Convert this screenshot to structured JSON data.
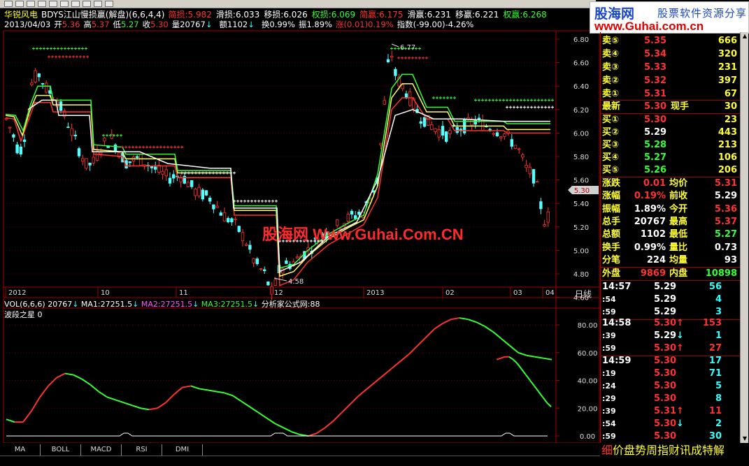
{
  "app": {
    "stock_name": "华锐风电",
    "formula": "BDYS江山慢损赢(解盘)(6,6,4,4)",
    "period": "日线"
  },
  "indicators_row1": [
    {
      "label": "简损:",
      "value": "5.982",
      "color": "red"
    },
    {
      "label": "滑损:",
      "value": "6.033",
      "color": "white"
    },
    {
      "label": "移损:",
      "value": "6.026",
      "color": "white"
    },
    {
      "label": "权损:",
      "value": "6.069",
      "color": "green"
    },
    {
      "label": "简赢:",
      "value": "6.175",
      "color": "red"
    },
    {
      "label": "滑赢:",
      "value": "6.231",
      "color": "white"
    },
    {
      "label": "移赢:",
      "value": "6.221",
      "color": "white"
    },
    {
      "label": "权赢:",
      "value": "6.268",
      "color": "green"
    }
  ],
  "ohlc_row": {
    "date": "2013/04/03",
    "open_label": "开",
    "open": "5.36",
    "high_label": "高",
    "high": "5.37",
    "low_label": "低",
    "low": "5.27",
    "close_label": "收",
    "close": "5.30",
    "vol_label": "量",
    "vol": "20767",
    "amt_label": "额",
    "amt": "1102",
    "turn_label": "换",
    "turn": "0.99%",
    "amp_label": "振",
    "amp": "1.89%",
    "chg_label": "涨",
    "chg": "(0.01)0.19%",
    "idx_label": "指数",
    "idx": "(-99.00)-4.26%"
  },
  "watermark": "股海网 Www.Guhai.Com.CN",
  "logo": {
    "title": "股海网",
    "subtitle": "股票软件资源分享",
    "url": "www.Guhai.com.cn"
  },
  "price_axis": [
    "6.80",
    "6.60",
    "6.40",
    "6.20",
    "6.00",
    "5.80",
    "5.60",
    "5.40",
    "5.20",
    "5.00",
    "4.80",
    "4.60"
  ],
  "current_price_tag": "5.30",
  "high_annotation": "6.77",
  "low_annotation": "4.58",
  "time_axis": [
    "2012",
    "10",
    "11",
    "12",
    "2013",
    "02",
    "03",
    "04"
  ],
  "vol_row": {
    "label": "VOL(6,6,6)",
    "vol": "20767",
    "ma1": "MA1:27251.5",
    "ma2": "MA2:27251.5",
    "ma3": "MA3:27251.5",
    "source": "分析家公式网:88"
  },
  "sub_indicator": {
    "name": "波段之星",
    "value": "0"
  },
  "sub_axis": [
    "80.00",
    "60.00",
    "40.00",
    "20.00",
    "0.00"
  ],
  "chart_data": {
    "type": "line",
    "title": "波段之星",
    "ylim": [
      0,
      90
    ],
    "x": [
      0,
      3,
      6,
      9,
      12,
      15,
      18,
      21,
      24,
      27,
      30,
      33,
      36,
      39,
      42,
      45,
      48,
      51,
      54,
      57,
      60,
      63,
      66,
      69,
      72,
      75,
      78,
      81,
      84,
      87,
      90,
      93,
      96,
      99,
      102,
      105,
      108,
      111,
      114,
      117,
      120,
      123,
      126,
      129,
      132,
      135,
      138,
      141,
      144,
      147,
      150,
      153,
      156,
      159,
      162,
      165,
      168,
      171,
      174,
      177,
      180,
      183,
      186,
      189,
      192,
      195
    ],
    "series": [
      {
        "values": [
          12,
          10,
          10,
          18,
          28,
          36,
          42,
          45,
          44,
          41,
          37,
          32,
          28,
          26,
          24,
          22,
          20,
          19,
          20,
          24,
          30,
          35,
          36,
          34,
          33,
          32,
          31,
          29,
          25,
          21,
          17,
          13,
          9,
          6,
          3,
          1,
          0,
          2,
          6,
          11,
          17,
          23,
          29,
          34,
          39,
          44,
          49,
          54,
          59,
          65,
          71,
          77,
          81,
          84,
          85,
          84,
          82,
          79,
          75,
          70,
          65,
          60,
          58,
          57,
          56,
          55
        ]
      },
      {
        "values": [
          55,
          56,
          57,
          57,
          55,
          52,
          48,
          44,
          40,
          36,
          32,
          28,
          24,
          21
        ]
      }
    ]
  },
  "quote": {
    "sell": [
      {
        "label": "卖⑤",
        "price": "5.35",
        "vol": "666"
      },
      {
        "label": "卖④",
        "price": "5.34",
        "vol": "320"
      },
      {
        "label": "卖③",
        "price": "5.33",
        "vol": "231"
      },
      {
        "label": "卖②",
        "price": "5.32",
        "vol": "397"
      },
      {
        "label": "卖①",
        "price": "5.31",
        "vol": "67"
      }
    ],
    "latest_label": "最新",
    "latest": "5.30",
    "now_label": "现手",
    "now": "30",
    "buy": [
      {
        "label": "买①",
        "price": "5.30",
        "vol": "23"
      },
      {
        "label": "买②",
        "price": "5.29",
        "vol": "443"
      },
      {
        "label": "买③",
        "price": "5.28",
        "vol": "213"
      },
      {
        "label": "买④",
        "price": "5.27",
        "vol": "106"
      },
      {
        "label": "买⑤",
        "price": "5.26",
        "vol": "206"
      }
    ],
    "stats": [
      {
        "l1": "涨跌",
        "v1": "0.01",
        "c1": "red",
        "l2": "均价",
        "v2": "5.31",
        "c2": "red"
      },
      {
        "l1": "涨幅",
        "v1": "0.19%",
        "c1": "red",
        "l2": "前收",
        "v2": "5.29",
        "c2": "white"
      },
      {
        "l1": "振幅",
        "v1": "1.89%",
        "c1": "white",
        "l2": "今开",
        "v2": "5.36",
        "c2": "red"
      },
      {
        "l1": "总手",
        "v1": "20767",
        "c1": "white",
        "l2": "最高",
        "v2": "5.37",
        "c2": "red"
      },
      {
        "l1": "总额",
        "v1": "1102",
        "c1": "white",
        "l2": "最低",
        "v2": "5.27",
        "c2": "green"
      },
      {
        "l1": "换手",
        "v1": "0.99%",
        "c1": "white",
        "l2": "量比",
        "v2": "0.73",
        "c2": "white"
      },
      {
        "l1": "分笔",
        "v1": "224",
        "c1": "white",
        "l2": "均量",
        "v2": "93",
        "c2": "white"
      }
    ],
    "outer_label": "外盘",
    "outer": "9869",
    "inner_label": "内盘",
    "inner": "10898"
  },
  "ticks": [
    {
      "time": "14:57",
      "price": "5.29",
      "arrow": "",
      "vol": "56",
      "pc": "white",
      "vc": "cyan"
    },
    {
      "time": ":54",
      "price": "5.29",
      "arrow": "",
      "vol": "4",
      "pc": "white",
      "vc": "cyan"
    },
    {
      "time": ":59",
      "price": "5.29",
      "arrow": "",
      "vol": "3",
      "pc": "white",
      "vc": "cyan"
    },
    {
      "time": "14:58",
      "price": "5.30",
      "arrow": "↑",
      "vol": "153",
      "pc": "red",
      "vc": "red"
    },
    {
      "time": ":39",
      "price": "5.29",
      "arrow": "↓",
      "vol": "1",
      "pc": "white",
      "vc": "cyan"
    },
    {
      "time": ":59",
      "price": "5.30",
      "arrow": "↑",
      "vol": "27",
      "pc": "red",
      "vc": "red"
    },
    {
      "time": "14:59",
      "price": "5.30",
      "arrow": "",
      "vol": "17",
      "pc": "red",
      "vc": "cyan"
    },
    {
      "time": ":19",
      "price": "5.30",
      "arrow": "",
      "vol": "71",
      "pc": "red",
      "vc": "cyan"
    },
    {
      "time": ":24",
      "price": "5.30",
      "arrow": "",
      "vol": "5",
      "pc": "red",
      "vc": "cyan"
    },
    {
      "time": ":29",
      "price": "5.30",
      "arrow": "",
      "vol": "8",
      "pc": "red",
      "vc": "cyan"
    },
    {
      "time": ":39",
      "price": "5.31",
      "arrow": "↑",
      "vol": "11",
      "pc": "red",
      "vc": "red"
    },
    {
      "time": ":54",
      "price": "5.30",
      "arrow": "↓",
      "vol": "2",
      "pc": "red",
      "vc": "cyan"
    },
    {
      "time": ":59",
      "price": "5.30",
      "arrow": "",
      "vol": "30",
      "pc": "red",
      "vc": "cyan"
    }
  ],
  "bottom_tabs": [
    "MA",
    "BOLL",
    "MACD",
    "RSI",
    "DMI"
  ],
  "bottom_right": {
    "first": "细",
    "rest": "价盘势周指财讯成特解"
  },
  "colors": {
    "up": "#ff3232",
    "down": "#54ffff",
    "green": "#33ff33",
    "yellow": "#ffff33"
  }
}
